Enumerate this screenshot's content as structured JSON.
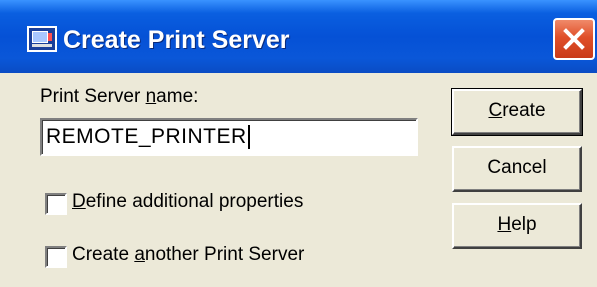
{
  "window": {
    "title": "Create Print Server",
    "icon": "print-server-app-icon",
    "close_icon": "close-icon"
  },
  "form": {
    "name_label_pre": "Print Server ",
    "name_label_ul": "n",
    "name_label_post": "ame:",
    "name_value": "REMOTE_PRINTER"
  },
  "options": {
    "define_pre": "",
    "define_ul": "D",
    "define_post": "efine additional properties",
    "define_checked": false,
    "another_pre": "Create ",
    "another_ul": "a",
    "another_post": "nother Print Server",
    "another_checked": false
  },
  "buttons": {
    "create_ul": "C",
    "create_post": "reate",
    "cancel": "Cancel",
    "help_ul": "H",
    "help_post": "elp"
  },
  "colors": {
    "titlebar": "#0551d6",
    "close": "#e0502a",
    "face": "#ece9d8"
  }
}
